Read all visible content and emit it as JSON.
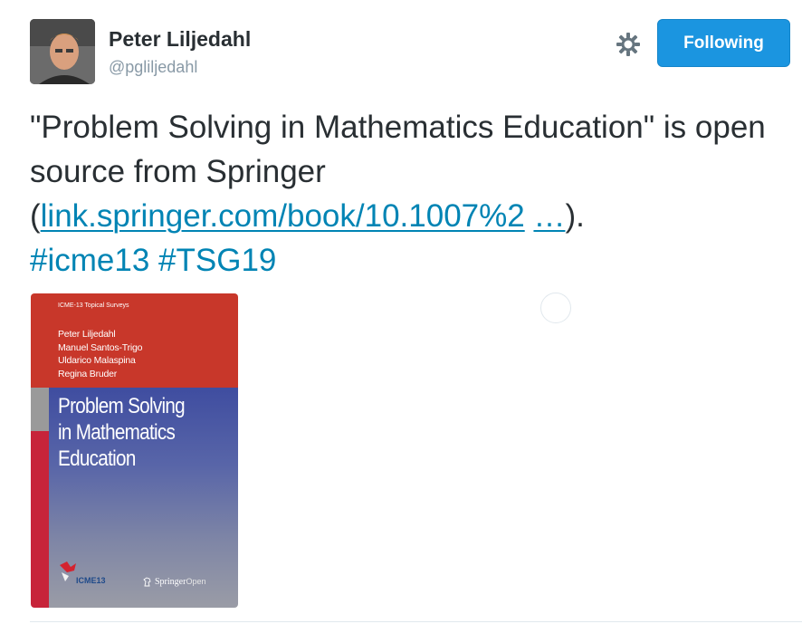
{
  "tweet": {
    "user": {
      "name": "Peter Liljedahl",
      "handle": "@pgliljedahl"
    },
    "follow_button_label": "Following",
    "text": {
      "part1": "\"Problem Solving in Mathematics Education\" is open source from Springer (",
      "link": "link.springer.com/book/10.1007%2",
      "ellipsis": "…",
      "part2": ").",
      "hashtag1": "#icme13",
      "hashtag2": "#TSG19"
    },
    "media": {
      "series": "ICME-13 Topical Surveys",
      "authors": [
        "Peter Liljedahl",
        "Manuel Santos-Trigo",
        "Uldarico Malaspina",
        "Regina Bruder"
      ],
      "title_lines": [
        "Problem Solving",
        "in Mathematics",
        "Education"
      ],
      "logo_text": "ICME13",
      "publisher": "Springer",
      "publisher_suffix": "Open"
    }
  },
  "icons": {
    "avatar": "avatar",
    "settings": "gear-icon",
    "loading": "loading-spinner-icon",
    "springer": "springer-horse-icon"
  },
  "colors": {
    "follow_button": "#1b95e0",
    "link": "#0084b4",
    "name": "#292f33",
    "handle": "#8899a6",
    "cover_red": "#c8372a",
    "cover_blue": "#3f4da0"
  }
}
